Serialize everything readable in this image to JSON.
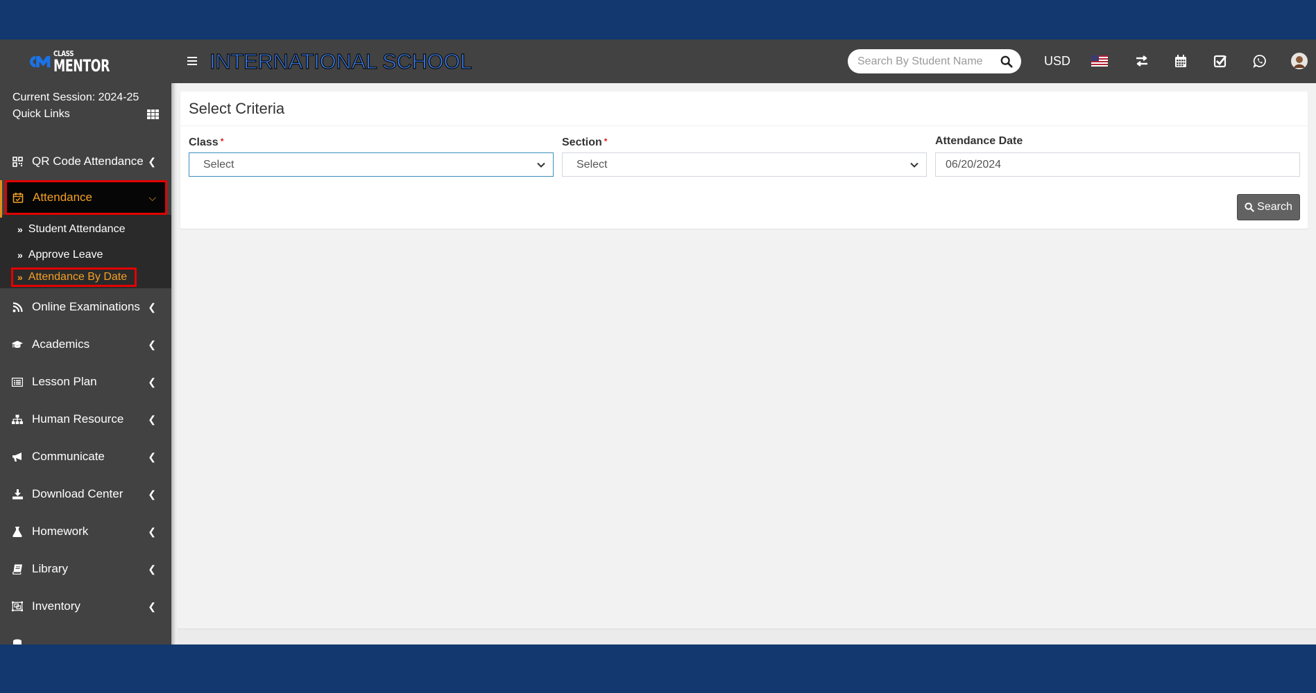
{
  "brand": {
    "logo_small": "CLASS",
    "logo_big": "MENTOR",
    "school_title": "INTERNATIONAL SCHOOL",
    "accent_color": "#3b82f6",
    "outer_background": "#12386f",
    "header_background": "#424242"
  },
  "header": {
    "search_placeholder": "Search By Student Name",
    "search_value": "",
    "currency": "USD",
    "icons": [
      "menu-icon",
      "search-icon",
      "us-flag-icon",
      "swap-icon",
      "calendar-icon",
      "task-check-icon",
      "whatsapp-icon",
      "user-avatar"
    ]
  },
  "sidebar": {
    "session_label": "Current Session: 2024-25",
    "quick_links_label": "Quick Links",
    "items": [
      {
        "label": "QR Code Attendance",
        "icon": "qrcode-icon",
        "expanded": false,
        "active": false
      },
      {
        "label": "Attendance",
        "icon": "calendar-check-icon",
        "expanded": true,
        "active": true,
        "children": [
          {
            "label": "Student Attendance",
            "active": false
          },
          {
            "label": "Approve Leave",
            "active": false
          },
          {
            "label": "Attendance By Date",
            "active": true
          }
        ]
      },
      {
        "label": "Online Examinations",
        "icon": "rss-icon",
        "expanded": false,
        "active": false
      },
      {
        "label": "Academics",
        "icon": "graduation-cap-icon",
        "expanded": false,
        "active": false
      },
      {
        "label": "Lesson Plan",
        "icon": "list-alt-icon",
        "expanded": false,
        "active": false
      },
      {
        "label": "Human Resource",
        "icon": "sitemap-icon",
        "expanded": false,
        "active": false
      },
      {
        "label": "Communicate",
        "icon": "bullhorn-icon",
        "expanded": false,
        "active": false
      },
      {
        "label": "Download Center",
        "icon": "download-icon",
        "expanded": false,
        "active": false
      },
      {
        "label": "Homework",
        "icon": "flask-icon",
        "expanded": false,
        "active": false
      },
      {
        "label": "Library",
        "icon": "book-icon",
        "expanded": false,
        "active": false
      },
      {
        "label": "Inventory",
        "icon": "object-group-icon",
        "expanded": false,
        "active": false
      }
    ],
    "active_color": "#f4a024",
    "highlight_border_color": "#e40000"
  },
  "main": {
    "card_title": "Select Criteria",
    "fields": {
      "class": {
        "label": "Class",
        "required": "*",
        "value": "Select"
      },
      "section": {
        "label": "Section",
        "required": "*",
        "value": "Select"
      },
      "attendance_date": {
        "label": "Attendance Date",
        "value": "06/20/2024"
      }
    },
    "search_button_label": "Search"
  }
}
